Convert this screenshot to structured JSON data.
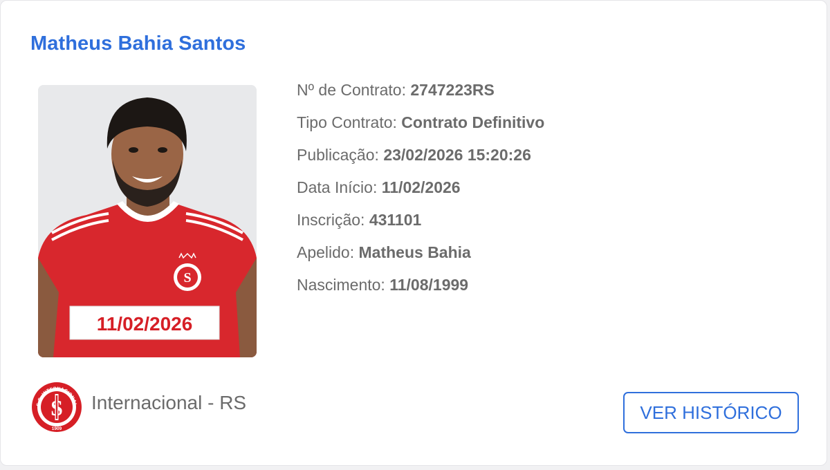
{
  "player": {
    "name": "Matheus Bahia Santos",
    "photo_date": "11/02/2026"
  },
  "details": [
    {
      "label": "Nº de Contrato:",
      "value": "2747223RS"
    },
    {
      "label": "Tipo Contrato:",
      "value": "Contrato Definitivo"
    },
    {
      "label": "Publicação:",
      "value": "23/02/2026 15:20:26"
    },
    {
      "label": "Data Início:",
      "value": "11/02/2026"
    },
    {
      "label": "Inscrição:",
      "value": "431101"
    },
    {
      "label": "Apelido:",
      "value": "Matheus Bahia"
    },
    {
      "label": "Nascimento:",
      "value": "11/08/1999"
    }
  ],
  "club": {
    "name": "Internacional - RS",
    "logo_icon": "internacional-crest-icon",
    "logo_ring_text": "S.C. INTERNACIONAL",
    "logo_year": "1909"
  },
  "actions": {
    "history_label": "VER HISTÓRICO"
  },
  "colors": {
    "accent": "#2f6fdc",
    "text": "#6b6b6b",
    "club_red": "#d61f26"
  }
}
